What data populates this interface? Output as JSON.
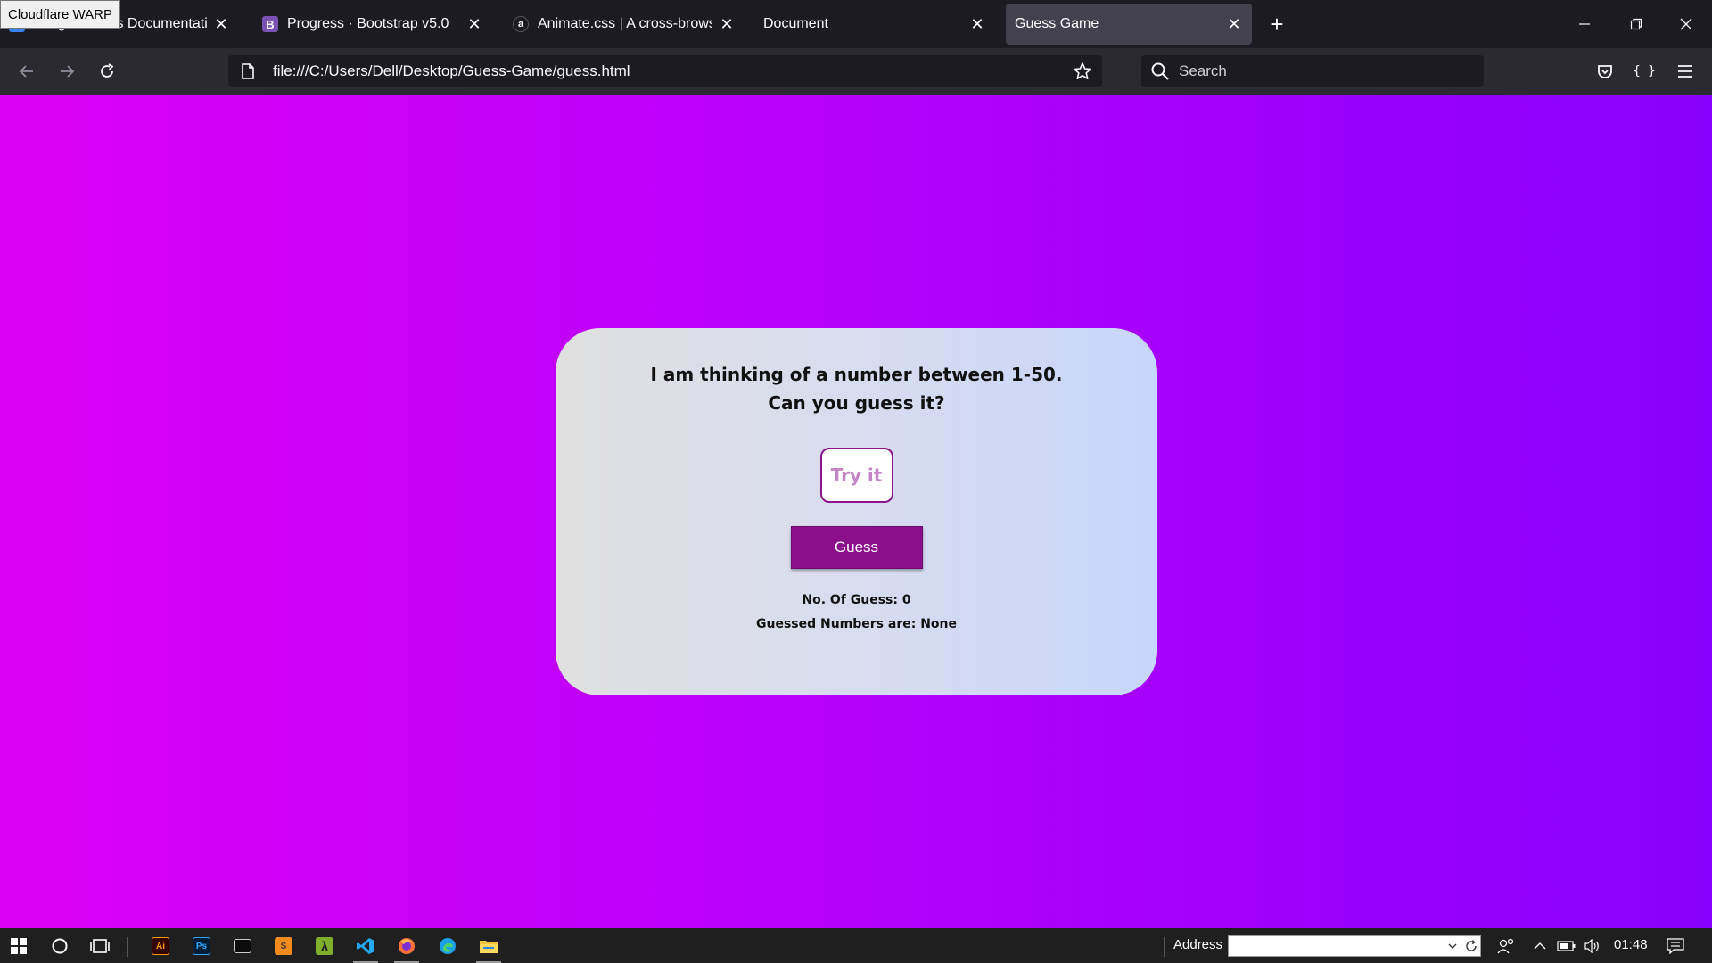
{
  "tooltip": "Cloudflare WARP",
  "tabs": [
    {
      "title": "ImageKit.io.ss Documentation",
      "favicon_color": "#3b82f6",
      "favicon_text": ""
    },
    {
      "title": "Progress · Bootstrap v5.0",
      "favicon_color": "#7952b3",
      "favicon_text": "B"
    },
    {
      "title": "Animate.css | A cross-browser li",
      "favicon_color": "#1c1b22",
      "favicon_text": "a"
    },
    {
      "title": "Document",
      "favicon_color": "",
      "favicon_text": ""
    },
    {
      "title": "Guess Game",
      "favicon_color": "",
      "favicon_text": ""
    }
  ],
  "active_tab": 4,
  "address": {
    "url": "file:///C:/Users/Dell/Desktop/Guess-Game/guess.html"
  },
  "search": {
    "placeholder": "Search"
  },
  "game": {
    "prompt_line1": "I am thinking of a number between 1-50.",
    "prompt_line2": "Can you guess it?",
    "input_placeholder": "Try it",
    "guess_button": "Guess",
    "guess_count": "No. Of Guess: 0",
    "guessed_numbers": "Guessed Numbers are: None"
  },
  "colors": {
    "bg_gradient_start": "#dd00f6",
    "bg_gradient_end": "#8800fd",
    "guess_button": "#8b0e8b"
  },
  "taskbar": {
    "apps": [
      "windows-start",
      "cortana",
      "task-view",
      "illustrator",
      "photoshop",
      "terminal",
      "sublime-text",
      "lambda-app",
      "vscode",
      "firefox",
      "edge",
      "file-explorer"
    ],
    "address_label": "Address",
    "time": "01:48"
  }
}
